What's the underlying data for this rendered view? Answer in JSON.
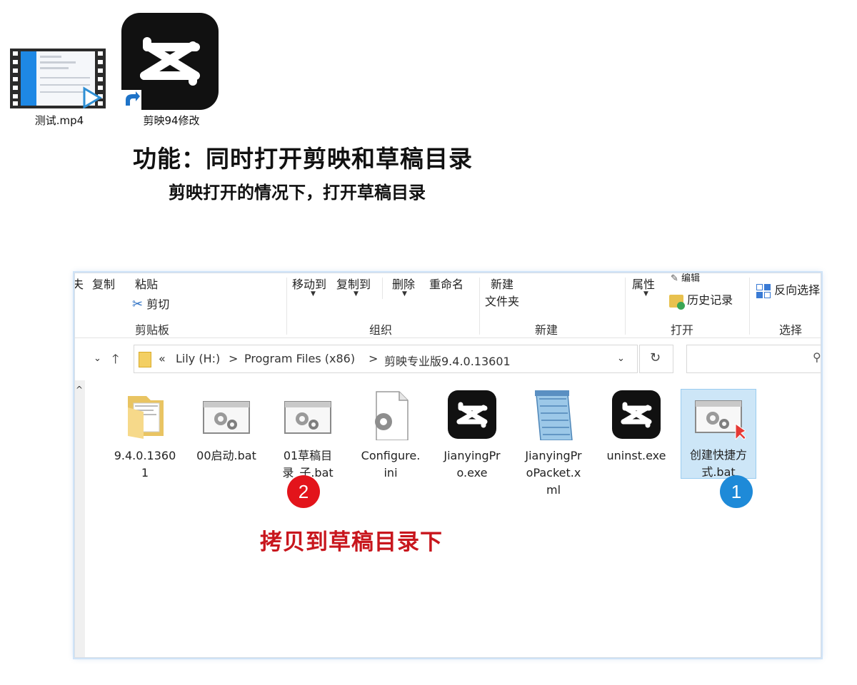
{
  "desktop": {
    "icons": [
      {
        "label": "测试.mp4",
        "icon": "video-file-icon"
      },
      {
        "label": "剪映94修改",
        "icon": "capcut-icon"
      }
    ]
  },
  "header": {
    "title": "功能：同时打开剪映和草稿目录",
    "subtitle": "剪映打开的情况下，打开草稿目录"
  },
  "ribbon": {
    "clipboard": {
      "copy": "复制",
      "paste": "粘贴",
      "cut": "剪切",
      "group": "剪贴板",
      "partial_left": "夫"
    },
    "organize": {
      "move_to": "移动到",
      "copy_to": "复制到",
      "delete": "删除",
      "rename": "重命名",
      "group": "组织"
    },
    "new": {
      "new_folder_line1": "新建",
      "new_folder_line2": "文件夹",
      "group": "新建"
    },
    "open": {
      "properties": "属性",
      "edit": "编辑",
      "history": "历史记录",
      "group": "打开"
    },
    "select": {
      "invert": "反向选择",
      "group": "选择"
    }
  },
  "addressbar": {
    "chevrons": "«",
    "crumbs": [
      "Lily (H:)",
      "Program Files (x86)",
      "剪映专业版9.4.0.13601"
    ],
    "separator": ">"
  },
  "files": [
    {
      "name": "9.4.0.13601",
      "icon": "folder-icon"
    },
    {
      "name": "00启动.bat",
      "icon": "bat-gear-icon"
    },
    {
      "name": "01草稿目录_子.bat",
      "icon": "bat-gear-icon"
    },
    {
      "name": "Configure.ini",
      "icon": "ini-config-icon"
    },
    {
      "name": "JianyingPro.exe",
      "icon": "capcut-icon"
    },
    {
      "name": "JianyingProPacket.xml",
      "icon": "notepad-icon"
    },
    {
      "name": "uninst.exe",
      "icon": "capcut-icon"
    },
    {
      "name": "创建快捷方式.bat",
      "icon": "bat-gear-icon"
    }
  ],
  "labels_display": {
    "f0": "9.4.0.1360\n1",
    "f2a": "01草稿目",
    "f2b": "录_子.bat",
    "f3a": "Configure.",
    "f3b": "ini",
    "f4a": "JianyingPr",
    "f4b": "o.exe",
    "f5a": "JianyingPr",
    "f5b": "oPacket.x",
    "f5c": "ml",
    "f7a": "创建快捷方",
    "f7b": "式.bat"
  },
  "badges": {
    "one": "1",
    "two": "2"
  },
  "annotation": "拷贝到草稿目录下",
  "colors": {
    "accent_red": "#c8161d",
    "badge_red": "#e3141b",
    "badge_blue": "#1e8ad8",
    "selection": "#cde6f7"
  }
}
